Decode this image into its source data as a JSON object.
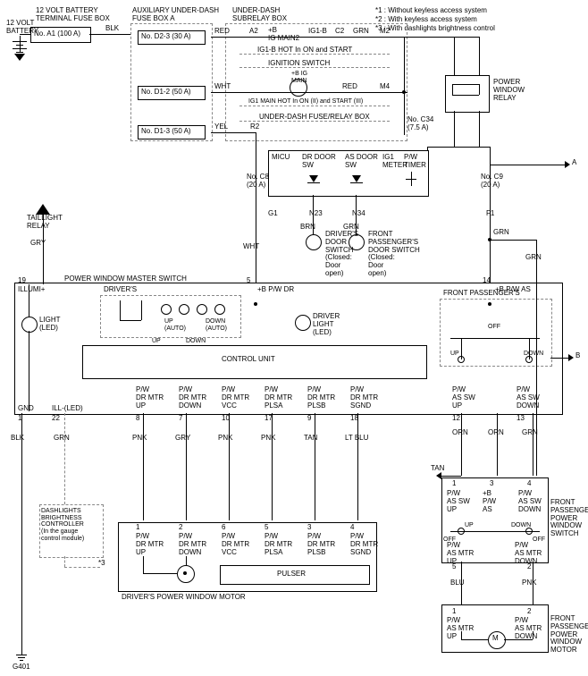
{
  "notes": {
    "n1": "*1 : Without keyless access system",
    "n2": "*2 : With keyless access system",
    "n3": "*3 : With dashlights brightness control"
  },
  "batt": {
    "label": "12 VOLT\nBATTERY",
    "boxTitle": "12 VOLT BATTERY\nTERMINAL FUSE BOX",
    "fuse": "No. A1 (100 A)"
  },
  "aux": {
    "title": "AUXILIARY UNDER-DASH\nFUSE BOX A",
    "f1": "No. D2-3 (30 A)",
    "f2": "No. D1-2 (50 A)",
    "f3": "No. D1-3 (50 A)"
  },
  "subrelay": {
    "title": "UNDER-DASH\nSUBRELAY BOX",
    "pinA2": "A2",
    "pinC2": "C2",
    "pinM2": "M2",
    "pinM4": "M4",
    "ig1b": "IG1-B",
    "plusB": "+B\nIG MAIN2",
    "ig1b_hot": "IG1-B HOT In ON and START",
    "ignSwitch": "IGNITION SWITCH",
    "ig_main": "+B IG\nMAIN",
    "ig1_main_hot": "IG1 MAIN HOT In ON (II) and START (III)",
    "underDashFuseRelay": "UNDER-DASH FUSE/RELAY BOX"
  },
  "fuses": {
    "c34": "No. C34\n(7.5 A)",
    "c8": "No. C8\n(20 A)",
    "c9": "No. C9\n(20 A)"
  },
  "relay": {
    "power": "POWER\nWINDOW\nRELAY",
    "taillight": "TAILLIGHT\nRELAY"
  },
  "micu": {
    "title": "MICU",
    "drDoorSw": "DR DOOR\nSW",
    "asDoorSw": "AS DOOR\nSW",
    "ig1": "IG1\nMETER",
    "pwTimer": "P/W\nTIMER"
  },
  "doorSw": {
    "driver": "DRIVER'S\nDOOR\nSWITCH\n(Closed:\nDoor\nopen)",
    "frontPass": "FRONT\nPASSENGER'S\nDOOR SWITCH\n(Closed:\nDoor\nopen)"
  },
  "master": {
    "title": "POWER WINDOW MASTER SWITCH",
    "drivers": "DRIVER'S",
    "frontPass": "FRONT PASSENGER'S",
    "ctrlUnit": "CONTROL UNIT",
    "lightLed": "LIGHT\n(LED)",
    "driverLightLed": "DRIVER\nLIGHT\n(LED)",
    "upAuto": "UP\n(AUTO)",
    "downAuto": "DOWN\n(AUTO)",
    "up": "UP",
    "down": "DOWN",
    "off": "OFF"
  },
  "terminals": {
    "t19": "19",
    "illumi": "ILLUMI+",
    "t5": "5",
    "bpwdr": "+B P/W DR",
    "t14": "14",
    "bpwas": "+B P/W AS",
    "gnd": "GND",
    "t1": "1",
    "illLed": "ILL-(LED)",
    "t22": "22",
    "t8": "8",
    "t7": "7",
    "t10": "10",
    "t17": "17",
    "t9": "9",
    "t18": "18",
    "t12": "12",
    "t13": "13"
  },
  "sigLabels": {
    "pwDrMtrUp": "P/W\nDR MTR\nUP",
    "pwDrMtrDown": "P/W\nDR MTR\nDOWN",
    "pwDrMtrVcc": "P/W\nDR MTR\nVCC",
    "pwDrMtrPlsa": "P/W\nDR MTR\nPLSA",
    "pwDrMtrPlsb": "P/W\nDR MTR\nPLSB",
    "pwDrMtrSgnd": "P/W\nDR MTR\nSGND",
    "pwAsSwUp": "P/W\nAS SW\nUP",
    "pwAsSwDown": "P/W\nAS SW\nDOWN"
  },
  "motorLabels": {
    "drMtrUp": "P/W\nDR MTR\nUP",
    "drMtrDown": "P/W\nDR MTR\nDOWN",
    "drMtrVcc": "P/W\nDR MTR\nVCC",
    "drMtrPlsa": "P/W\nDR MTR\nPLSA",
    "drMtrPlsb": "P/W\nDR MTR\nPLSB",
    "drMtrSgnd": "P/W\nDR MTR\nSGND",
    "pulser": "PULSER"
  },
  "passSwitch": {
    "title": "FRONT\nPASSENGER'S\nPOWER\nWINDOW\nSWITCH",
    "plusB_pw_as": "+B\nP/W\nAS",
    "off": "OFF",
    "up": "UP",
    "down": "DOWN",
    "asMtrUp": "P/W\nAS MTR\nUP",
    "asMtrDown": "P/W\nAS MTR\nDOWN"
  },
  "passMotor": {
    "title": "FRONT\nPASSENGER'S\nPOWER\nWINDOW\nMOTOR"
  },
  "driverMotor": "DRIVER'S POWER WINDOW MOTOR",
  "dashlights": "DASHLIGHTS\nBRIGHTNESS\nCONTROLLER\n(In the gauge\ncontrol module)",
  "colors": {
    "blk": "BLK",
    "red": "RED",
    "wht": "WHT",
    "yel": "YEL",
    "grn": "GRN",
    "gry": "GRY",
    "brn": "BRN",
    "pnk": "PNK",
    "tan": "TAN",
    "ltblu": "LT BLU",
    "orn": "ORN",
    "blu": "BLU"
  },
  "refs": {
    "A": "A",
    "B": "B",
    "g401": "G401",
    "g1": "G1",
    "n23": "N23",
    "n34": "N34",
    "f1": "F1",
    "r2": "R2",
    "star3": "*3"
  },
  "nums": {
    "n1": "1",
    "n2": "2",
    "n3": "3",
    "n4": "4",
    "n5": "5",
    "n6": "6"
  }
}
